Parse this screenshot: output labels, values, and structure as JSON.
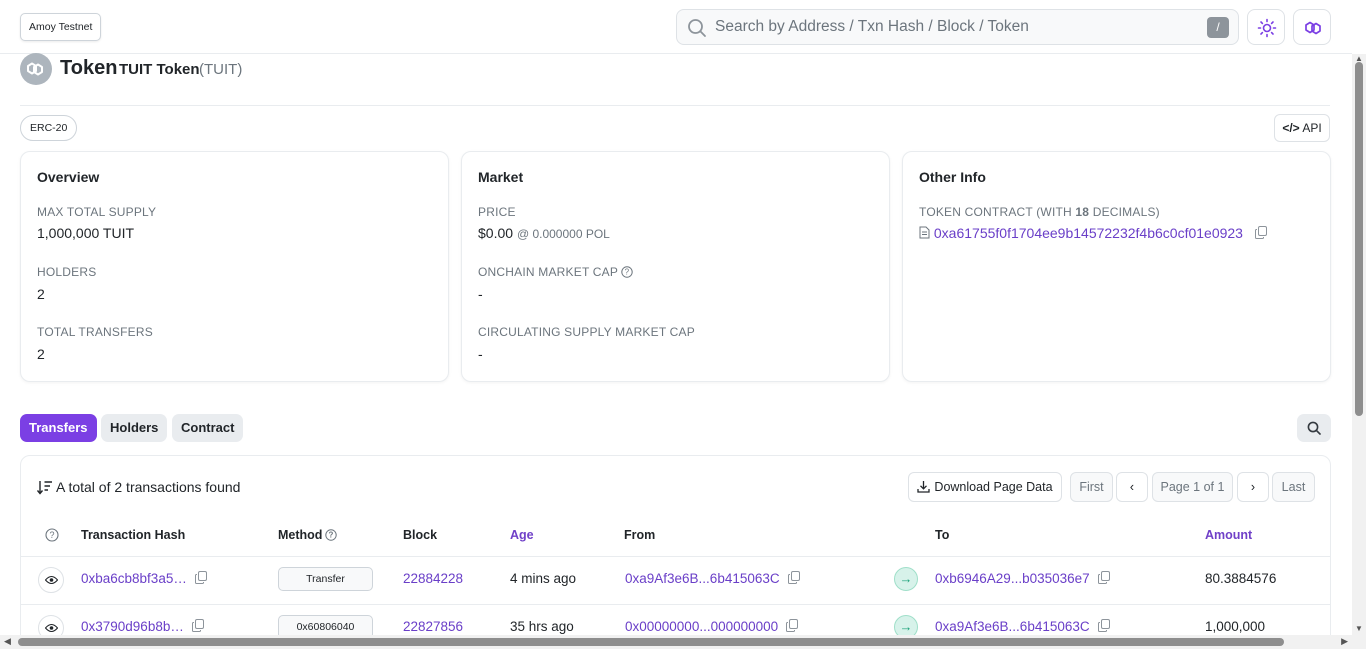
{
  "header": {
    "network_badge": "Amoy Testnet",
    "search_placeholder": "Search by Address / Txn Hash / Block / Token",
    "search_shortcut": "/",
    "icons": [
      "search-icon",
      "sun-icon",
      "polygon-logo-icon"
    ]
  },
  "title": {
    "heading": "Token",
    "token_name": "TUIT Token",
    "token_symbol": "(TUIT)"
  },
  "badges": {
    "standard": "ERC-20",
    "api_label": "API"
  },
  "overview": {
    "title": "Overview",
    "max_supply_label": "MAX TOTAL SUPPLY",
    "max_supply_value": "1,000,000 TUIT",
    "holders_label": "HOLDERS",
    "holders_value": "2",
    "transfers_label": "TOTAL TRANSFERS",
    "transfers_value": "2"
  },
  "market": {
    "title": "Market",
    "price_label": "PRICE",
    "price_value": "$0.00",
    "price_sub": "@ 0.000000 POL",
    "mcap_label": "ONCHAIN MARKET CAP",
    "mcap_value": "-",
    "circ_label": "CIRCULATING SUPPLY MARKET CAP",
    "circ_value": "-"
  },
  "other_info": {
    "title": "Other Info",
    "contract_label_pre": "TOKEN CONTRACT (WITH ",
    "contract_decimals": "18",
    "contract_label_post": " DECIMALS)",
    "contract_address": "0xa61755f0f1704ee9b14572232f4b6c0cf01e0923"
  },
  "tabs": [
    {
      "label": "Transfers",
      "active": true
    },
    {
      "label": "Holders",
      "active": false
    },
    {
      "label": "Contract",
      "active": false
    }
  ],
  "transfers": {
    "summary": "A total of 2 transactions found",
    "download_label": "Download Page Data",
    "pagination": {
      "first": "First",
      "page": "Page 1 of 1",
      "last": "Last"
    },
    "columns": [
      "Transaction Hash",
      "Method",
      "Block",
      "Age",
      "From",
      "To",
      "Amount"
    ],
    "rows": [
      {
        "hash": "0xba6cb8bf3a5…",
        "method": "Transfer",
        "block": "22884228",
        "age": "4 mins ago",
        "from": "0xa9Af3e6B...6b415063C",
        "to": "0xb6946A29...b035036e7",
        "amount": "80.3884576"
      },
      {
        "hash": "0x3790d96b8b…",
        "method": "0x60806040",
        "block": "22827856",
        "age": "35 hrs ago",
        "from": "0x00000000...000000000",
        "to": "0xa9Af3e6B...6b415063C",
        "amount": "1,000,000"
      }
    ]
  },
  "colors": {
    "accent": "#7b3fe4",
    "link": "#6a3fc8",
    "in_arrow": "#1aa179"
  }
}
